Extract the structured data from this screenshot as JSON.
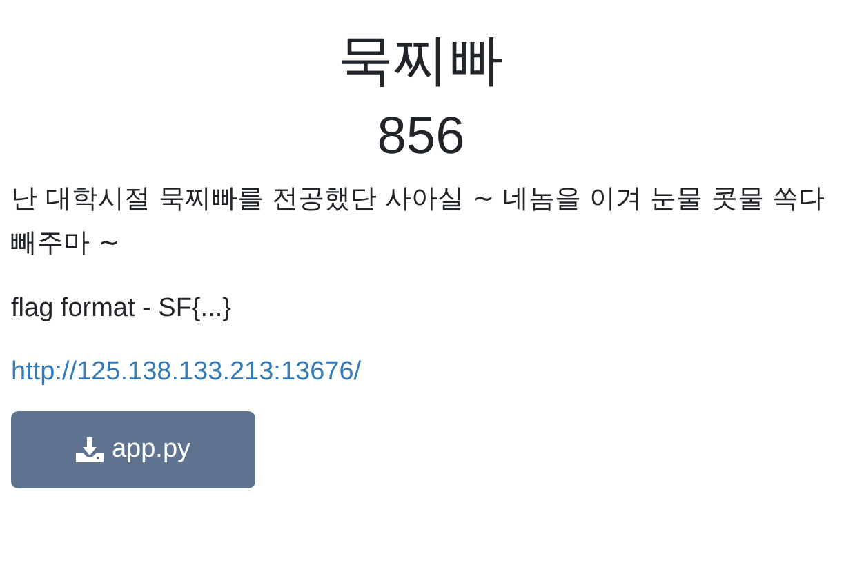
{
  "title": "묵찌빠",
  "points": "856",
  "description": "난 대학시절 묵찌빠를 전공했단 사아실 ~ 네놈을 이겨 눈물 콧물 쏙다 빼주마 ~",
  "flag_format": "flag format - SF{...}",
  "link": "http://125.138.133.213:13676/",
  "download_button": "app.py"
}
